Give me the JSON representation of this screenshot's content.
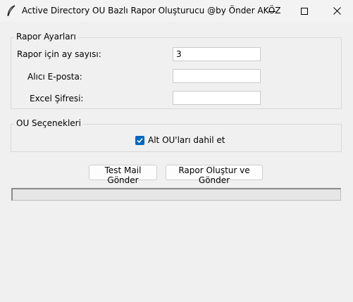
{
  "window": {
    "title": "Active Directory OU Bazlı Rapor Oluşturucu @by Önder AKÖZ",
    "icon": "feather-icon"
  },
  "report_settings": {
    "legend": "Rapor Ayarları",
    "months_label": "Rapor için ay sayısı:",
    "months_value": "3",
    "email_label": "Alıcı E-posta:",
    "email_value": "",
    "password_label": "Excel Şifresi:",
    "password_value": ""
  },
  "ou_options": {
    "legend": "OU Seçenekleri",
    "include_sub_ous_label": "Alt OU'ları dahil et",
    "include_sub_ous_checked": true
  },
  "actions": {
    "test_mail_label": "Test Mail Gönder",
    "create_report_label": "Rapor Oluştur ve Gönder"
  },
  "progress": {
    "value_percent": 0
  },
  "colors": {
    "accent": "#0067c0",
    "progress": "#06b025"
  }
}
